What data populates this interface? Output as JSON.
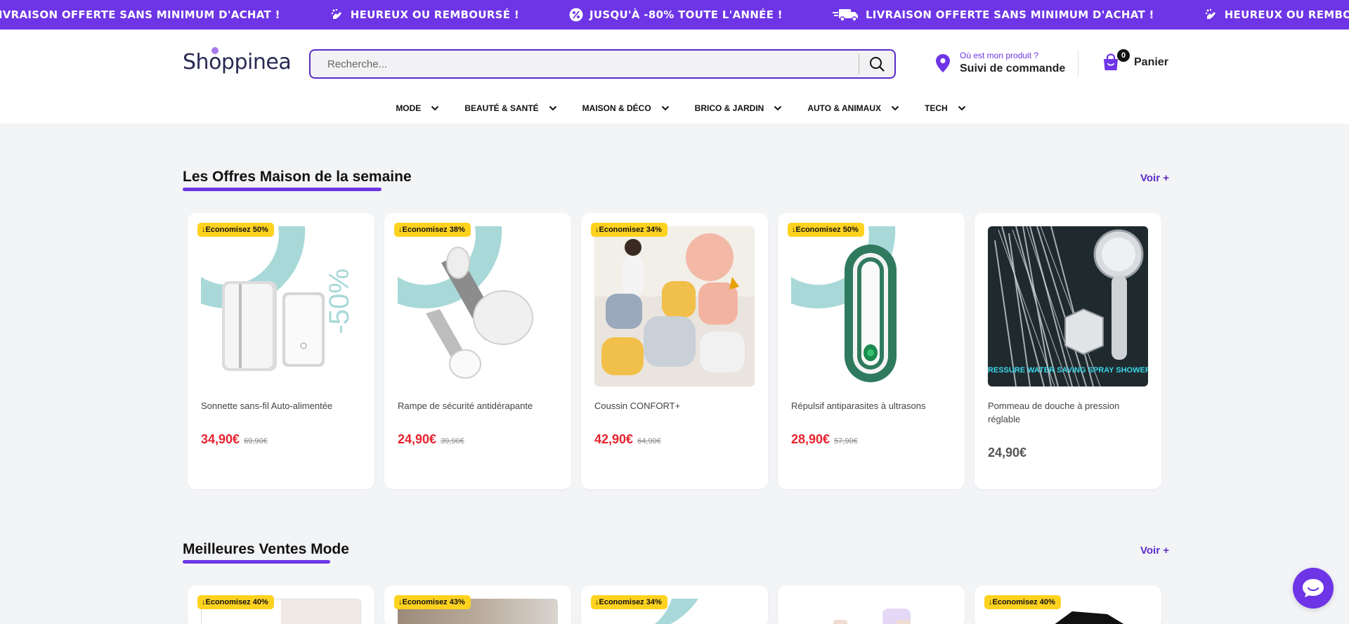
{
  "announcements": [
    {
      "icon": "truck-icon",
      "text": "LIVRAISON OFFERTE SANS MINIMUM D'ACHAT !"
    },
    {
      "icon": "hand-sparkle-icon",
      "text": "HEUREUX OU REMBOURSÉ !"
    },
    {
      "icon": "percent-icon",
      "text": "JUSQU'À -80% TOUTE L'ANNÉE !"
    },
    {
      "icon": "truck-icon",
      "text": "LIVRAISON OFFERTE SANS MINIMUM D'ACHAT !"
    },
    {
      "icon": "hand-sparkle-icon",
      "text": "HEUREUX OU REMBOURSÉ !"
    }
  ],
  "header": {
    "logo": {
      "before": "Sh",
      "o": "o",
      "after": "ppinea"
    },
    "search_placeholder": "Recherche...",
    "tracking": {
      "small": "Où est mon produit ?",
      "big": "Suivi de commande"
    },
    "cart": {
      "count": "0",
      "label": "Panier"
    }
  },
  "nav": [
    {
      "label": "MODE"
    },
    {
      "label": "BEAUTÉ & SANTÉ"
    },
    {
      "label": "MAISON & DÉCO"
    },
    {
      "label": "BRICO & JARDIN"
    },
    {
      "label": "AUTO & ANIMAUX"
    },
    {
      "label": "TECH"
    }
  ],
  "sections": [
    {
      "title": "Les Offres Maison de la semaine",
      "more": "Voir +",
      "products": [
        {
          "badge": "Economisez 50%",
          "name": "Sonnette sans-fil Auto-alimentée",
          "price": "34,90€",
          "old": "69,90€",
          "image": "doorbell",
          "overlay": "-50%"
        },
        {
          "badge": "Economisez 38%",
          "name": "Rampe de sécurité antidérapante",
          "price": "24,90€",
          "old": "39,90€",
          "image": "grab-bar"
        },
        {
          "badge": "Economisez 34%",
          "name": "Coussin CONFORT+",
          "price": "42,90€",
          "old": "64,90€",
          "image": "cushions"
        },
        {
          "badge": "Economisez 50%",
          "name": "Répulsif antiparasites à ultrasons",
          "price": "28,90€",
          "old": "57,90€",
          "image": "repeller"
        },
        {
          "badge": "",
          "name": "Pommeau de douche à pression réglable",
          "price": "24,90€",
          "old": "",
          "image": "shower",
          "overlay": "HIGH PRESSURE WATER SAVING SPRAY SHOWER HEAD"
        }
      ]
    },
    {
      "title": "Meilleures Ventes Mode",
      "more": "Voir +",
      "products": [
        {
          "badge": "Economisez 40%"
        },
        {
          "badge": "Economisez 43%"
        },
        {
          "badge": "Economisez 34%"
        },
        {
          "badge": ""
        },
        {
          "badge": "Economisez 40%"
        }
      ]
    }
  ],
  "colors": {
    "brand": "#6d35e6",
    "sale_price": "#e8232e",
    "badge": "#ffd21f"
  }
}
